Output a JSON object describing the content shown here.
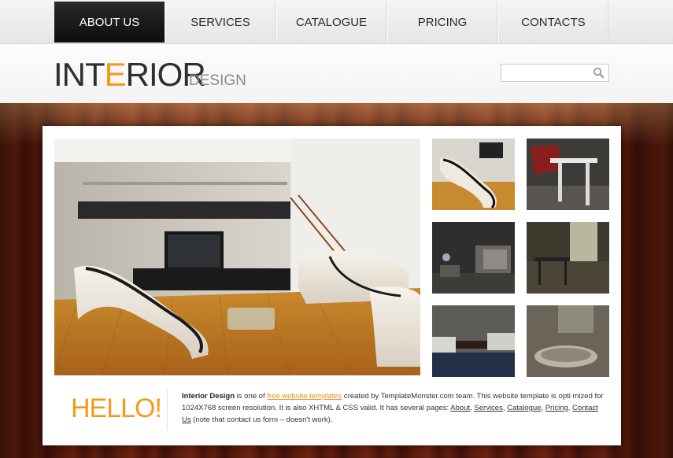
{
  "nav": {
    "items": [
      {
        "label": "ABOUT US",
        "active": true
      },
      {
        "label": "SERVICES",
        "active": false
      },
      {
        "label": "CATALOGUE",
        "active": false
      },
      {
        "label": "PRICING",
        "active": false
      },
      {
        "label": "CONTACTS",
        "active": false
      }
    ]
  },
  "header": {
    "logo_part1": "INT",
    "logo_accent": "E",
    "logo_part2": "RIOR",
    "logo_sub": "DESIGN",
    "search_placeholder": "",
    "search_icon": "magnifier-icon"
  },
  "content": {
    "hello": "HELLO!",
    "intro": {
      "brand": "Interior Design",
      "t1": " is one of ",
      "link_free": "free website templates",
      "t2": " created by TemplateMonster.com team. This website template is opti mized for 1024X768 screen resolution. It is also XHTML & CSS valid. It has several pages: ",
      "link_about": "About",
      "sep1": ", ",
      "link_services": "Services",
      "sep2": ", ",
      "link_catalogue": "Catalogue",
      "sep3": ", ",
      "link_pricing": "Pricing",
      "sep4": ", ",
      "link_contacts": "Contact Us",
      "t3": " (note that contact us form – doesn't work)."
    }
  },
  "colors": {
    "accent": "#f39a1a",
    "nav_active": "#111111",
    "wood": "#5a1a0c"
  }
}
